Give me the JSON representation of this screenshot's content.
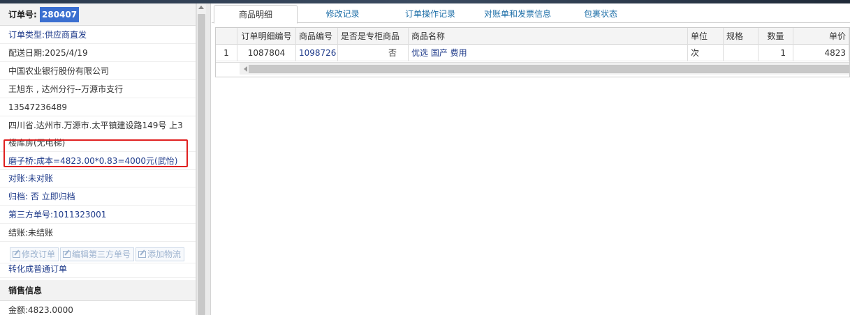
{
  "left_panel": {
    "order_label": "订单号:",
    "order_number": "280407",
    "rows": [
      {
        "text": "订单类型:供应商直发",
        "style": "blue"
      },
      {
        "text": "配送日期:2025/4/19",
        "style": "dark"
      },
      {
        "text": "中国农业银行股份有限公司",
        "style": "dark"
      },
      {
        "text": "王旭东 , 达州分行--万源市支行",
        "style": "dark"
      },
      {
        "text": "13547236489",
        "style": "dark"
      },
      {
        "text": "四川省.达州市.万源市.太平镇建设路149号 上3",
        "style": "dark"
      },
      {
        "text": "楼库房(无电梯)",
        "style": "dark"
      },
      {
        "text": "磨子桥:成本=4823.00*0.83=4000元(武怡)",
        "style": "blue"
      },
      {
        "text": "对账:未对账",
        "style": "blue"
      },
      {
        "text": "归档: 否 立即归档",
        "style": "blue"
      },
      {
        "text": "第三方单号:1011323001",
        "style": "blue"
      },
      {
        "text": "结账:未结账",
        "style": "dark"
      }
    ],
    "buttons": {
      "edit_order": "修改订单",
      "edit_third_party": "编辑第三方单号",
      "add_logistics": "添加物流"
    },
    "convert_label": "转化成普通订单",
    "sales_header": "销售信息",
    "amount_row": "金额:4823.0000"
  },
  "tabs": [
    {
      "label": "商品明细",
      "active": true
    },
    {
      "label": "修改记录",
      "active": false
    },
    {
      "label": "订单操作记录",
      "active": false
    },
    {
      "label": "对账单和发票信息",
      "active": false
    },
    {
      "label": "包裹状态",
      "active": false
    }
  ],
  "grid": {
    "headers": [
      "",
      "订单明细编号",
      "商品编号",
      "是否是专柜商品",
      "商品名称",
      "单位",
      "规格",
      "数量",
      "单价"
    ],
    "rows": [
      [
        "1",
        "1087804",
        "1098726",
        "否",
        "优选 国产 费用",
        "次",
        "",
        "1",
        "4823"
      ]
    ]
  }
}
